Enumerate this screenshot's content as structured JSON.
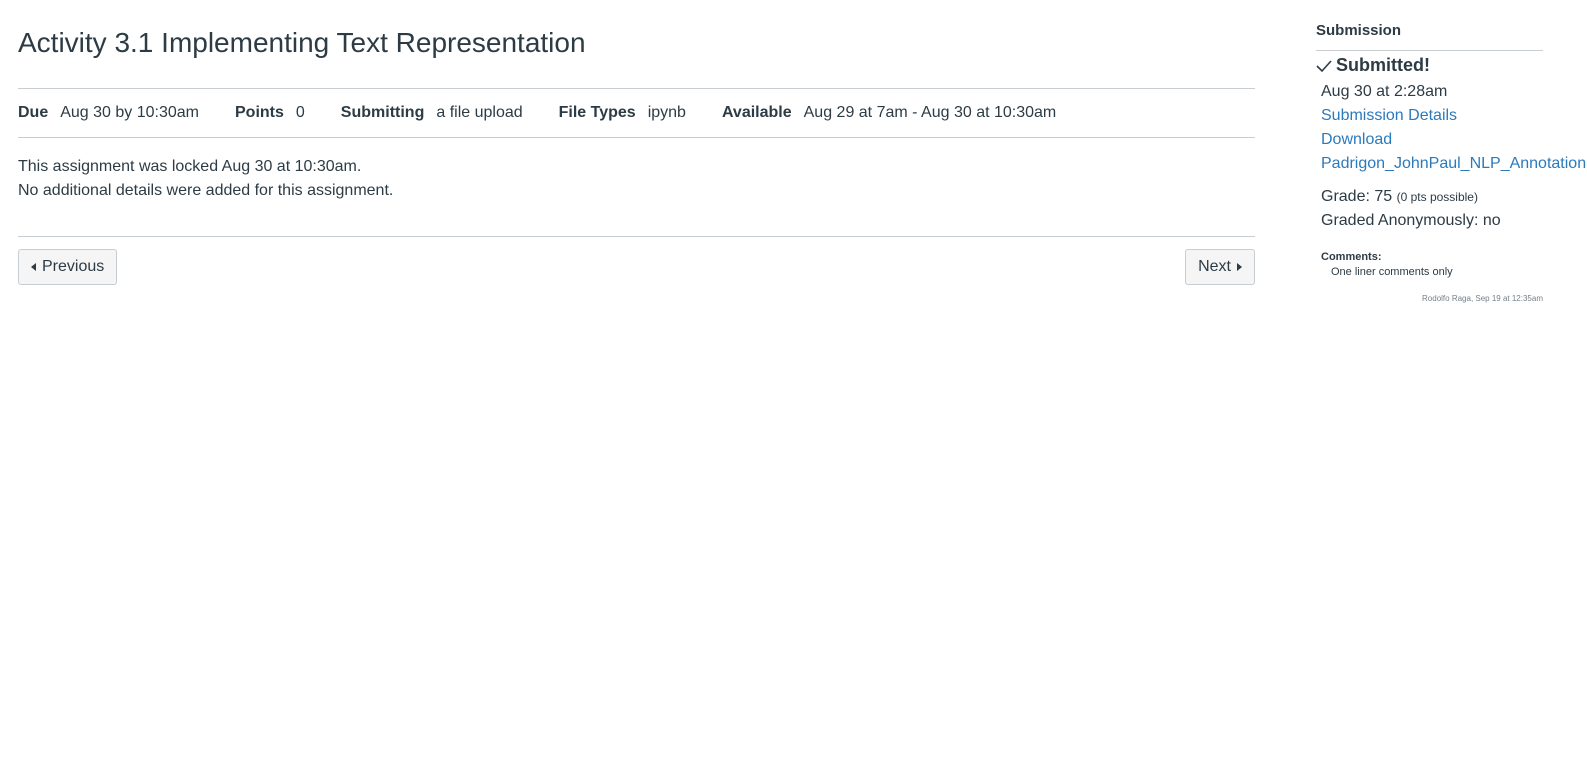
{
  "assignment": {
    "title": "Activity 3.1 Implementing Text Representation",
    "details": {
      "due_label": "Due",
      "due_value": "Aug 30 by 10:30am",
      "points_label": "Points",
      "points_value": "0",
      "submitting_label": "Submitting",
      "submitting_value": "a file upload",
      "file_types_label": "File Types",
      "file_types_value": "ipynb",
      "available_label": "Available",
      "available_value": "Aug 29 at 7am - Aug 30 at 10:30am"
    },
    "locked_message": "This assignment was locked Aug 30 at 10:30am.",
    "no_details_message": "No additional details were added for this assignment."
  },
  "navigation": {
    "previous_label": "Previous",
    "next_label": "Next"
  },
  "submission": {
    "heading": "Submission",
    "status": "Submitted!",
    "submitted_at": "Aug 30 at 2:28am",
    "details_link": "Submission Details",
    "download_link": "Download",
    "file_link": "Padrigon_JohnPaul_NLP_Annotation",
    "grade_label": "Grade: 75",
    "grade_possible": "(0 pts possible)",
    "graded_anonymously": "Graded Anonymously: no",
    "comments_label": "Comments:",
    "comment_text": "One liner comments only",
    "comment_meta": "Rodolfo Raga, Sep 19 at 12:35am"
  },
  "icons": {
    "check": "check-icon",
    "previous": "caret-left-icon",
    "next": "caret-right-icon"
  },
  "colors": {
    "text": "#2d3b45",
    "link": "#2b7abc",
    "border": "#c7cdd1",
    "button_bg": "#f5f5f5"
  }
}
